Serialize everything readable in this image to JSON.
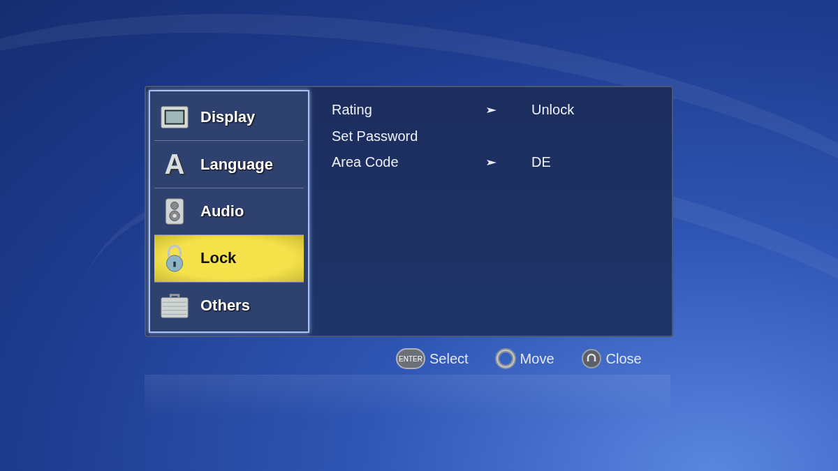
{
  "categories": [
    {
      "label": "Display",
      "kind": "display",
      "selected": false
    },
    {
      "label": "Language",
      "kind": "language",
      "glyph": "A",
      "selected": false
    },
    {
      "label": "Audio",
      "kind": "audio",
      "selected": false
    },
    {
      "label": "Lock",
      "kind": "lock",
      "selected": true
    },
    {
      "label": "Others",
      "kind": "others",
      "selected": false
    }
  ],
  "settings": [
    {
      "label": "Rating",
      "kind": "option",
      "value": "Unlock"
    },
    {
      "label": "Set Password",
      "kind": "action"
    },
    {
      "label": "Area Code",
      "kind": "option",
      "value": "DE"
    }
  ],
  "hints": [
    {
      "kind": "enter",
      "key_label": "ENTER",
      "label": "Select"
    },
    {
      "kind": "move",
      "label": "Move"
    },
    {
      "kind": "return",
      "label": "Close"
    }
  ]
}
